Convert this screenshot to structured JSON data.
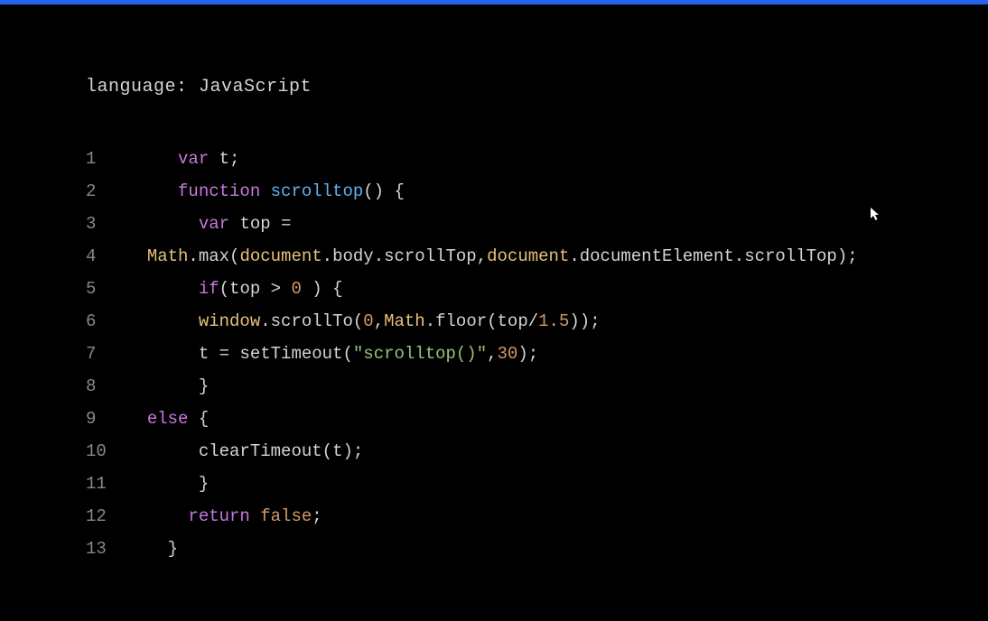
{
  "header": {
    "language_label": "language: ",
    "language_value": "JavaScript"
  },
  "code": {
    "lines": [
      {
        "num": "1"
      },
      {
        "num": "2"
      },
      {
        "num": "3"
      },
      {
        "num": "4"
      },
      {
        "num": "5"
      },
      {
        "num": "6"
      },
      {
        "num": "7"
      },
      {
        "num": "8"
      },
      {
        "num": "9"
      },
      {
        "num": "10"
      },
      {
        "num": "11"
      },
      {
        "num": "12"
      },
      {
        "num": "13"
      }
    ],
    "tokens": {
      "var_kw": "var",
      "function_kw": "function",
      "if_kw": "if",
      "else_kw": "else",
      "return_kw": "return",
      "false_kw": "false",
      "t_var": "t",
      "scrolltop_fn": "scrolltop",
      "top_var": "top",
      "math_cls": "Math",
      "max_fn": "max",
      "document_cls": "document",
      "body_prop": "body",
      "scrollTop_prop": "scrollTop",
      "documentElement_prop": "documentElement",
      "window_var": "window",
      "scrollTo_fn": "scrollTo",
      "floor_fn": "floor",
      "setTimeout_fn": "setTimeout",
      "clearTimeout_fn": "clearTimeout",
      "zero": "0",
      "one_five": "1.5",
      "thirty": "30",
      "scrolltop_str": "\"scrolltop()\"",
      "eq": " = ",
      "gt": " > ",
      "dot": ".",
      "comma": ",",
      "semi": ";",
      "lparen": "(",
      "rparen": ")",
      "lbrace": "{",
      "rbrace": "}",
      "slash": "/",
      "space": " ",
      "empty": "() "
    }
  }
}
